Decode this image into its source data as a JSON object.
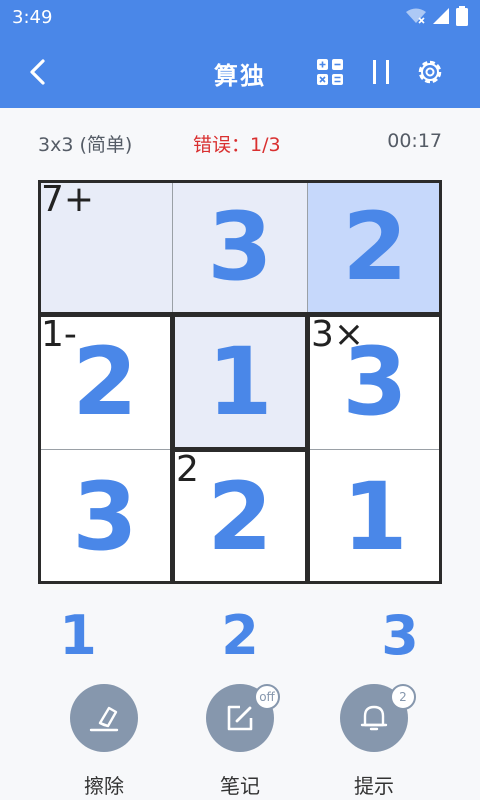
{
  "status_bar": {
    "time": "3:49"
  },
  "app_bar": {
    "title": "算独"
  },
  "info": {
    "size_label": "3x3 (简单)",
    "errors_label": "错误：1/3",
    "timer": "00:17"
  },
  "grid": {
    "cells": [
      {
        "row": 0,
        "col": 0,
        "value": "",
        "cage_label": "7+",
        "bg": "#e8ecf8"
      },
      {
        "row": 0,
        "col": 1,
        "value": "3",
        "cage_label": "",
        "bg": "#e8ecf8"
      },
      {
        "row": 0,
        "col": 2,
        "value": "2",
        "cage_label": "",
        "bg": "#c6d8fb"
      },
      {
        "row": 1,
        "col": 0,
        "value": "2",
        "cage_label": "1-",
        "bg": "#ffffff"
      },
      {
        "row": 1,
        "col": 1,
        "value": "1",
        "cage_label": "",
        "bg": "#e8ecf8"
      },
      {
        "row": 1,
        "col": 2,
        "value": "3",
        "cage_label": "3×",
        "bg": "#ffffff"
      },
      {
        "row": 2,
        "col": 0,
        "value": "3",
        "cage_label": "",
        "bg": "#ffffff"
      },
      {
        "row": 2,
        "col": 1,
        "value": "2",
        "cage_label": "2",
        "bg": "#ffffff"
      },
      {
        "row": 2,
        "col": 2,
        "value": "1",
        "cage_label": "",
        "bg": "#ffffff"
      }
    ]
  },
  "number_pad": [
    "1",
    "2",
    "3"
  ],
  "actions": {
    "erase": {
      "label": "擦除",
      "icon": "eraser-icon"
    },
    "notes": {
      "label": "笔记",
      "icon": "pencil-icon",
      "badge": "off"
    },
    "hint": {
      "label": "提示",
      "icon": "bell-icon",
      "badge": "2"
    }
  },
  "colors": {
    "primary": "#4a87e8",
    "error": "#d93030",
    "action_bg": "#8697ad"
  }
}
